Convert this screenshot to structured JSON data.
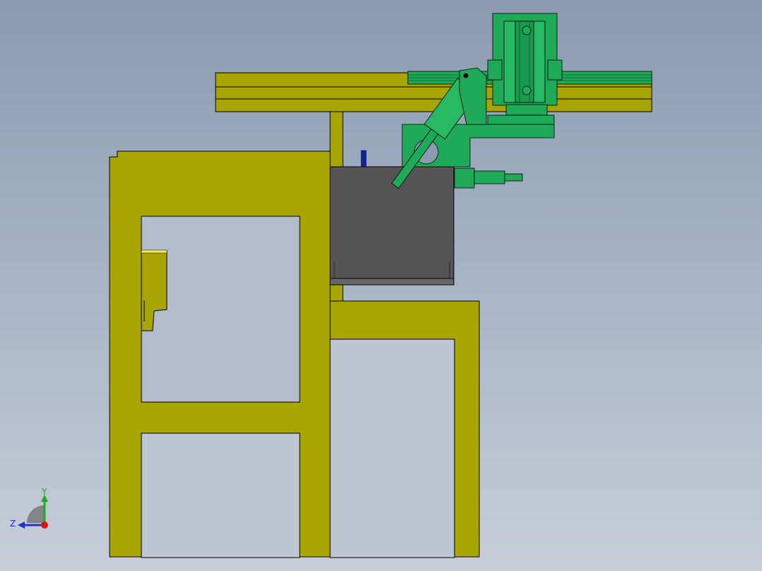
{
  "viewport": {
    "background_top": "#8a9bb0",
    "background_bottom": "#c7ced8"
  },
  "colors": {
    "frame": "#a8a400",
    "frame_highlight": "#f2ee60",
    "pneumatic": "#1faa59",
    "pneumatic_dark": "#0f7a3c",
    "box": "#555555",
    "blue_pins": "#1020a0",
    "outline": "#000000"
  },
  "triad": {
    "y_label": "Y",
    "z_label": "Z",
    "y_color": "#22aa22",
    "z_color": "#2233cc",
    "origin_color": "#dd1111"
  }
}
